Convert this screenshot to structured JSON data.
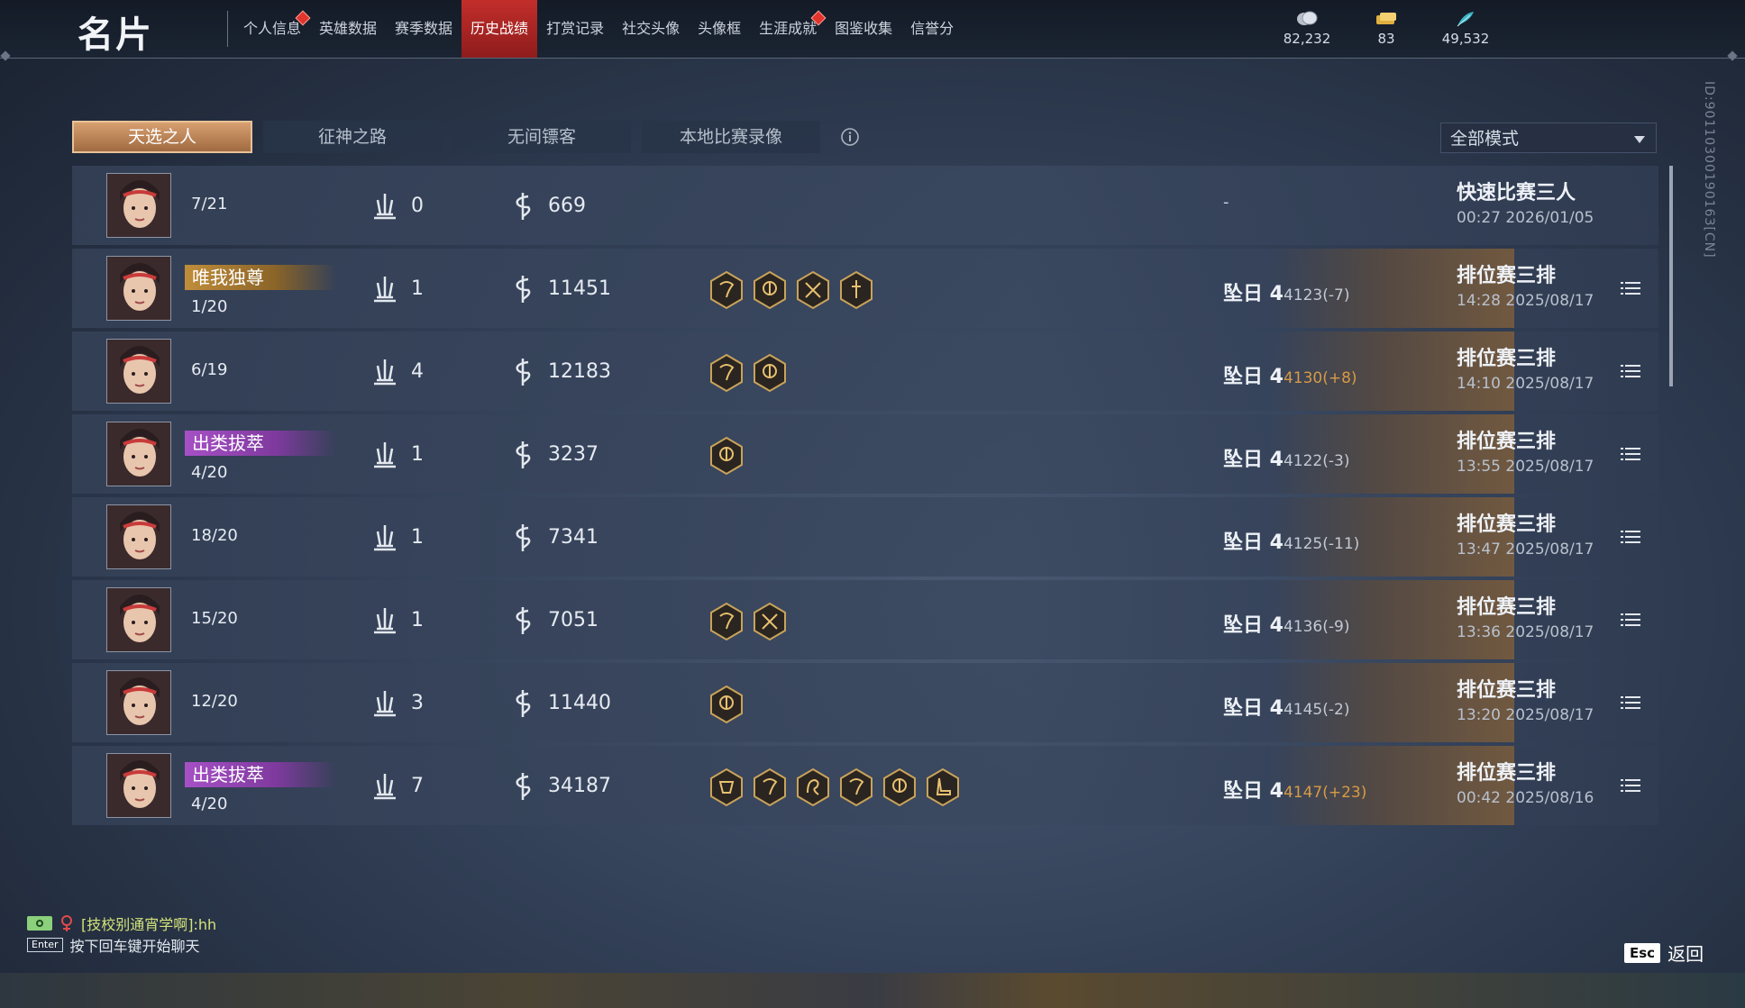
{
  "header": {
    "title": "名片",
    "nav": [
      {
        "label": "个人信息",
        "active": false,
        "dot": true
      },
      {
        "label": "英雄数据",
        "active": false,
        "dot": false
      },
      {
        "label": "赛季数据",
        "active": false,
        "dot": false
      },
      {
        "label": "历史战绩",
        "active": true,
        "dot": false
      },
      {
        "label": "打赏记录",
        "active": false,
        "dot": false
      },
      {
        "label": "社交头像",
        "active": false,
        "dot": false
      },
      {
        "label": "头像框",
        "active": false,
        "dot": false
      },
      {
        "label": "生涯成就",
        "active": false,
        "dot": true
      },
      {
        "label": "图鉴收集",
        "active": false,
        "dot": false
      },
      {
        "label": "信誉分",
        "active": false,
        "dot": false
      }
    ],
    "currencies": [
      {
        "icon": "coin-icon",
        "value": "82,232"
      },
      {
        "icon": "ticket-icon",
        "value": "83"
      },
      {
        "icon": "feather-icon",
        "value": "49,532"
      }
    ],
    "id_text": "ID:9011030019016З[CN]"
  },
  "tabs": [
    "天选之人",
    "征神之路",
    "无间镖客",
    "本地比赛录像"
  ],
  "active_tab": 0,
  "mode_select": "全部模式",
  "rows": [
    {
      "badge": "",
      "badge_color": "",
      "rank": "7/21",
      "kills": "0",
      "damage": "669",
      "medals": [],
      "tier": "",
      "tier_pts": "",
      "tier_up": false,
      "dash": "-",
      "mode": "快速比赛三人",
      "time": "00:27  2026/01/05",
      "detail": false
    },
    {
      "badge": "唯我独尊",
      "badge_color": "gold",
      "rank": "1/20",
      "kills": "1",
      "damage": "11451",
      "medals": [
        "medal-claw",
        "medal-helm",
        "medal-cross",
        "medal-sword"
      ],
      "tier": "坠日 4",
      "tier_pts": "4123(-7)",
      "tier_up": false,
      "dash": "",
      "mode": "排位赛三排",
      "time": "14:28  2025/08/17",
      "detail": true
    },
    {
      "badge": "",
      "badge_color": "",
      "rank": "6/19",
      "kills": "4",
      "damage": "12183",
      "medals": [
        "medal-claw",
        "medal-helm"
      ],
      "tier": "坠日 4",
      "tier_pts": "4130(+8)",
      "tier_up": true,
      "dash": "",
      "mode": "排位赛三排",
      "time": "14:10  2025/08/17",
      "detail": true
    },
    {
      "badge": "出类拔萃",
      "badge_color": "purple",
      "rank": "4/20",
      "kills": "1",
      "damage": "3237",
      "medals": [
        "medal-helm"
      ],
      "tier": "坠日 4",
      "tier_pts": "4122(-3)",
      "tier_up": false,
      "dash": "",
      "mode": "排位赛三排",
      "time": "13:55  2025/08/17",
      "detail": true
    },
    {
      "badge": "",
      "badge_color": "",
      "rank": "18/20",
      "kills": "1",
      "damage": "7341",
      "medals": [],
      "tier": "坠日 4",
      "tier_pts": "4125(-11)",
      "tier_up": false,
      "dash": "",
      "mode": "排位赛三排",
      "time": "13:47  2025/08/17",
      "detail": true
    },
    {
      "badge": "",
      "badge_color": "",
      "rank": "15/20",
      "kills": "1",
      "damage": "7051",
      "medals": [
        "medal-claw",
        "medal-cross"
      ],
      "tier": "坠日 4",
      "tier_pts": "4136(-9)",
      "tier_up": false,
      "dash": "",
      "mode": "排位赛三排",
      "time": "13:36  2025/08/17",
      "detail": true
    },
    {
      "badge": "",
      "badge_color": "",
      "rank": "12/20",
      "kills": "3",
      "damage": "11440",
      "medals": [
        "medal-helm"
      ],
      "tier": "坠日 4",
      "tier_pts": "4145(-2)",
      "tier_up": false,
      "dash": "",
      "mode": "排位赛三排",
      "time": "13:20  2025/08/17",
      "detail": true
    },
    {
      "badge": "出类拔萃",
      "badge_color": "purple",
      "rank": "4/20",
      "kills": "7",
      "damage": "34187",
      "medals": [
        "medal-mask",
        "medal-claw",
        "medal-dragon",
        "medal-claw",
        "medal-helm",
        "medal-boot"
      ],
      "tier": "坠日 4",
      "tier_pts": "4147(+23)",
      "tier_up": true,
      "dash": "",
      "mode": "排位赛三排",
      "time": "00:42  2025/08/16",
      "detail": true
    }
  ],
  "chat": {
    "speaker": "[技校别通宵学啊]:hh",
    "enter_key": "Enter",
    "hint": "按下回车键开始聊天"
  },
  "esc": {
    "key": "Esc",
    "label": "返回"
  },
  "colors": {
    "active_nav": "#c22e2a",
    "active_tab": "#c08a5a",
    "badge_gold": "#c08d3a",
    "badge_purple": "#a650c6",
    "pts_up": "#d79a45"
  }
}
